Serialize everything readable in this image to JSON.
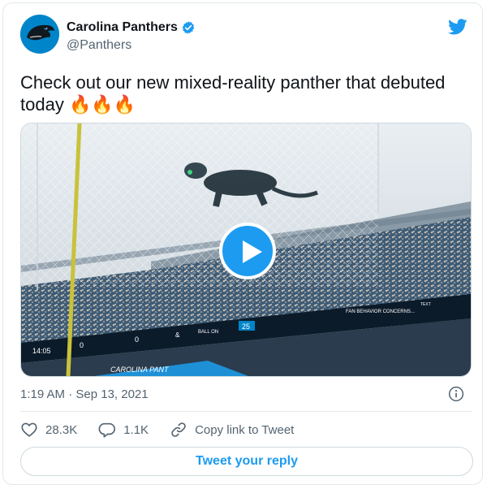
{
  "author": {
    "name": "Carolina Panthers",
    "handle": "@Panthers",
    "verified": true
  },
  "tweet": {
    "text": "Check out our new mixed-reality panther that debuted today",
    "emoji": "🔥🔥🔥"
  },
  "media": {
    "type": "video",
    "scoreboard": {
      "clock": "14:05",
      "left_score": "0",
      "right_score": "0",
      "ball_on": "BALL ON",
      "yard": "25",
      "amp": "&",
      "message": "FAN BEHAVIOR CONCERNS...",
      "text_line": "TEXT",
      "stadium_text": "CAROLINA PANT"
    }
  },
  "timestamp": "1:19 AM · Sep 13, 2021",
  "actions": {
    "likes": "28.3K",
    "replies": "1.1K",
    "copy_link": "Copy link to Tweet"
  },
  "reply_button": "Tweet your reply",
  "colors": {
    "accent": "#1d9bf0",
    "avatar_bg": "#0085ca"
  }
}
